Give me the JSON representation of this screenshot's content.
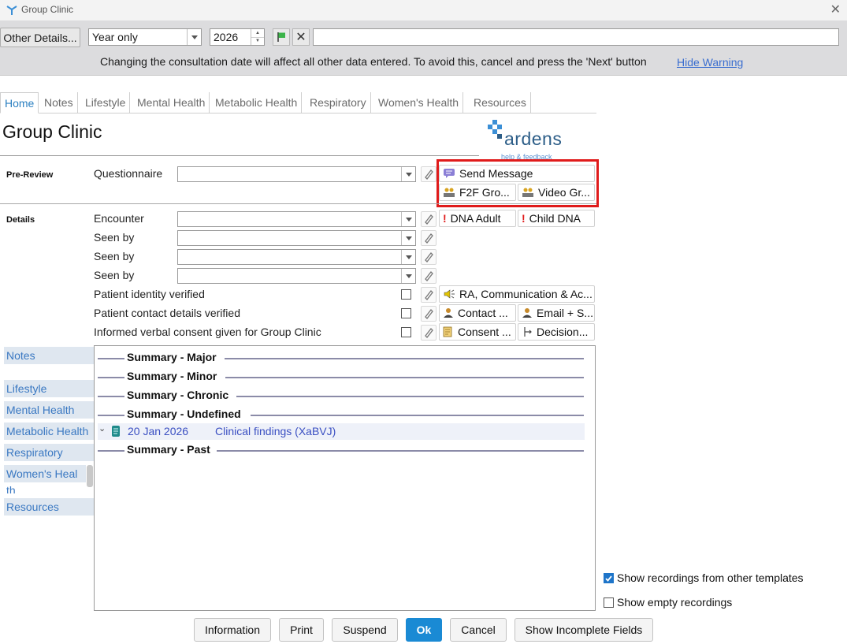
{
  "window": {
    "title": "Group Clinic"
  },
  "toolbar": {
    "other_details_label": "Other Details...",
    "date_mode": "Year only",
    "year": "2026",
    "warning": "Changing the consultation date will affect all other data entered. To avoid this, cancel and press the 'Next' button",
    "hide_warning_label": "Hide Warning"
  },
  "tabs": [
    "Home",
    "Notes",
    "Lifestyle",
    "Mental Health",
    "Metabolic Health",
    "Respiratory",
    "Women's Health",
    "Resources"
  ],
  "header": {
    "title": "Group Clinic",
    "brand": "ardens",
    "brand_sub": "help & feedback"
  },
  "pre_review": {
    "label": "Pre-Review",
    "questionnaire_label": "Questionnaire",
    "send_message": "Send Message",
    "f2f_group": "F2F Gro...",
    "video_group": "Video Gr..."
  },
  "details": {
    "label": "Details",
    "encounter_label": "Encounter",
    "seen_by_label": "Seen by",
    "dna_adult": "DNA Adult",
    "child_dna": "Child DNA",
    "identity_label": "Patient identity verified",
    "ra_comm": "RA, Communication & Ac...",
    "contact_details_label": "Patient contact details verified",
    "contact_btn": "Contact ...",
    "email_btn": "Email + S...",
    "consent_label": "Informed verbal consent given for Group Clinic",
    "consent_btn": "Consent ...",
    "decision_btn": "Decision..."
  },
  "left_nav": [
    "Notes",
    "Lifestyle",
    "Mental Health",
    "Metabolic Health",
    "Respiratory",
    "Women's Heal",
    "th",
    "Resources"
  ],
  "summary": {
    "major": "Summary - Major",
    "minor": "Summary - Minor",
    "chronic": "Summary - Chronic",
    "undefined": "Summary - Undefined",
    "entry_date": "20 Jan 2026",
    "entry_text": "Clinical findings (XaBVJ)",
    "past": "Summary - Past"
  },
  "options": {
    "show_other": "Show recordings from other templates",
    "show_other_checked": true,
    "show_empty": "Show empty recordings",
    "show_empty_checked": false
  },
  "buttons": {
    "information": "Information",
    "print": "Print",
    "suspend": "Suspend",
    "ok": "Ok",
    "cancel": "Cancel",
    "show_incomplete": "Show Incomplete Fields"
  },
  "colors": {
    "accent": "#1a8ad4",
    "highlight": "#e01b1b",
    "link": "#3a78c2"
  }
}
